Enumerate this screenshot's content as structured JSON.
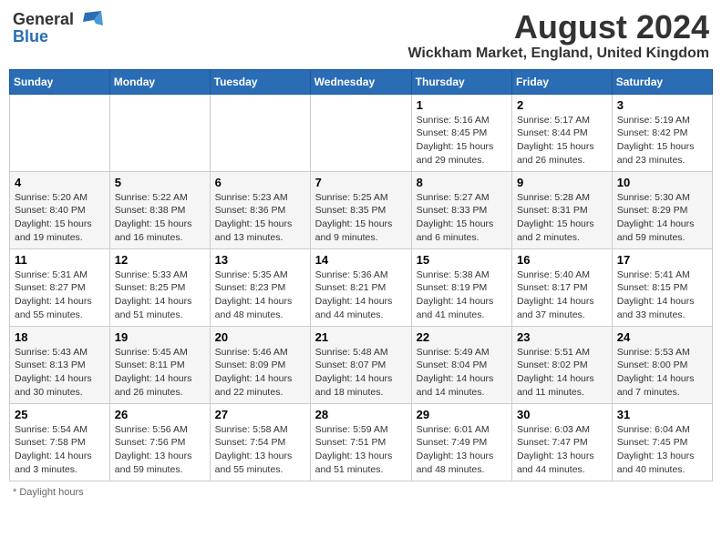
{
  "header": {
    "logo_general": "General",
    "logo_blue": "Blue",
    "month_title": "August 2024",
    "location": "Wickham Market, England, United Kingdom"
  },
  "days_of_week": [
    "Sunday",
    "Monday",
    "Tuesday",
    "Wednesday",
    "Thursday",
    "Friday",
    "Saturday"
  ],
  "weeks": [
    [
      {
        "day": "",
        "info": ""
      },
      {
        "day": "",
        "info": ""
      },
      {
        "day": "",
        "info": ""
      },
      {
        "day": "",
        "info": ""
      },
      {
        "day": "1",
        "info": "Sunrise: 5:16 AM\nSunset: 8:45 PM\nDaylight: 15 hours\nand 29 minutes."
      },
      {
        "day": "2",
        "info": "Sunrise: 5:17 AM\nSunset: 8:44 PM\nDaylight: 15 hours\nand 26 minutes."
      },
      {
        "day": "3",
        "info": "Sunrise: 5:19 AM\nSunset: 8:42 PM\nDaylight: 15 hours\nand 23 minutes."
      }
    ],
    [
      {
        "day": "4",
        "info": "Sunrise: 5:20 AM\nSunset: 8:40 PM\nDaylight: 15 hours\nand 19 minutes."
      },
      {
        "day": "5",
        "info": "Sunrise: 5:22 AM\nSunset: 8:38 PM\nDaylight: 15 hours\nand 16 minutes."
      },
      {
        "day": "6",
        "info": "Sunrise: 5:23 AM\nSunset: 8:36 PM\nDaylight: 15 hours\nand 13 minutes."
      },
      {
        "day": "7",
        "info": "Sunrise: 5:25 AM\nSunset: 8:35 PM\nDaylight: 15 hours\nand 9 minutes."
      },
      {
        "day": "8",
        "info": "Sunrise: 5:27 AM\nSunset: 8:33 PM\nDaylight: 15 hours\nand 6 minutes."
      },
      {
        "day": "9",
        "info": "Sunrise: 5:28 AM\nSunset: 8:31 PM\nDaylight: 15 hours\nand 2 minutes."
      },
      {
        "day": "10",
        "info": "Sunrise: 5:30 AM\nSunset: 8:29 PM\nDaylight: 14 hours\nand 59 minutes."
      }
    ],
    [
      {
        "day": "11",
        "info": "Sunrise: 5:31 AM\nSunset: 8:27 PM\nDaylight: 14 hours\nand 55 minutes."
      },
      {
        "day": "12",
        "info": "Sunrise: 5:33 AM\nSunset: 8:25 PM\nDaylight: 14 hours\nand 51 minutes."
      },
      {
        "day": "13",
        "info": "Sunrise: 5:35 AM\nSunset: 8:23 PM\nDaylight: 14 hours\nand 48 minutes."
      },
      {
        "day": "14",
        "info": "Sunrise: 5:36 AM\nSunset: 8:21 PM\nDaylight: 14 hours\nand 44 minutes."
      },
      {
        "day": "15",
        "info": "Sunrise: 5:38 AM\nSunset: 8:19 PM\nDaylight: 14 hours\nand 41 minutes."
      },
      {
        "day": "16",
        "info": "Sunrise: 5:40 AM\nSunset: 8:17 PM\nDaylight: 14 hours\nand 37 minutes."
      },
      {
        "day": "17",
        "info": "Sunrise: 5:41 AM\nSunset: 8:15 PM\nDaylight: 14 hours\nand 33 minutes."
      }
    ],
    [
      {
        "day": "18",
        "info": "Sunrise: 5:43 AM\nSunset: 8:13 PM\nDaylight: 14 hours\nand 30 minutes."
      },
      {
        "day": "19",
        "info": "Sunrise: 5:45 AM\nSunset: 8:11 PM\nDaylight: 14 hours\nand 26 minutes."
      },
      {
        "day": "20",
        "info": "Sunrise: 5:46 AM\nSunset: 8:09 PM\nDaylight: 14 hours\nand 22 minutes."
      },
      {
        "day": "21",
        "info": "Sunrise: 5:48 AM\nSunset: 8:07 PM\nDaylight: 14 hours\nand 18 minutes."
      },
      {
        "day": "22",
        "info": "Sunrise: 5:49 AM\nSunset: 8:04 PM\nDaylight: 14 hours\nand 14 minutes."
      },
      {
        "day": "23",
        "info": "Sunrise: 5:51 AM\nSunset: 8:02 PM\nDaylight: 14 hours\nand 11 minutes."
      },
      {
        "day": "24",
        "info": "Sunrise: 5:53 AM\nSunset: 8:00 PM\nDaylight: 14 hours\nand 7 minutes."
      }
    ],
    [
      {
        "day": "25",
        "info": "Sunrise: 5:54 AM\nSunset: 7:58 PM\nDaylight: 14 hours\nand 3 minutes."
      },
      {
        "day": "26",
        "info": "Sunrise: 5:56 AM\nSunset: 7:56 PM\nDaylight: 13 hours\nand 59 minutes."
      },
      {
        "day": "27",
        "info": "Sunrise: 5:58 AM\nSunset: 7:54 PM\nDaylight: 13 hours\nand 55 minutes."
      },
      {
        "day": "28",
        "info": "Sunrise: 5:59 AM\nSunset: 7:51 PM\nDaylight: 13 hours\nand 51 minutes."
      },
      {
        "day": "29",
        "info": "Sunrise: 6:01 AM\nSunset: 7:49 PM\nDaylight: 13 hours\nand 48 minutes."
      },
      {
        "day": "30",
        "info": "Sunrise: 6:03 AM\nSunset: 7:47 PM\nDaylight: 13 hours\nand 44 minutes."
      },
      {
        "day": "31",
        "info": "Sunrise: 6:04 AM\nSunset: 7:45 PM\nDaylight: 13 hours\nand 40 minutes."
      }
    ]
  ],
  "footer": {
    "note": "Daylight hours"
  }
}
